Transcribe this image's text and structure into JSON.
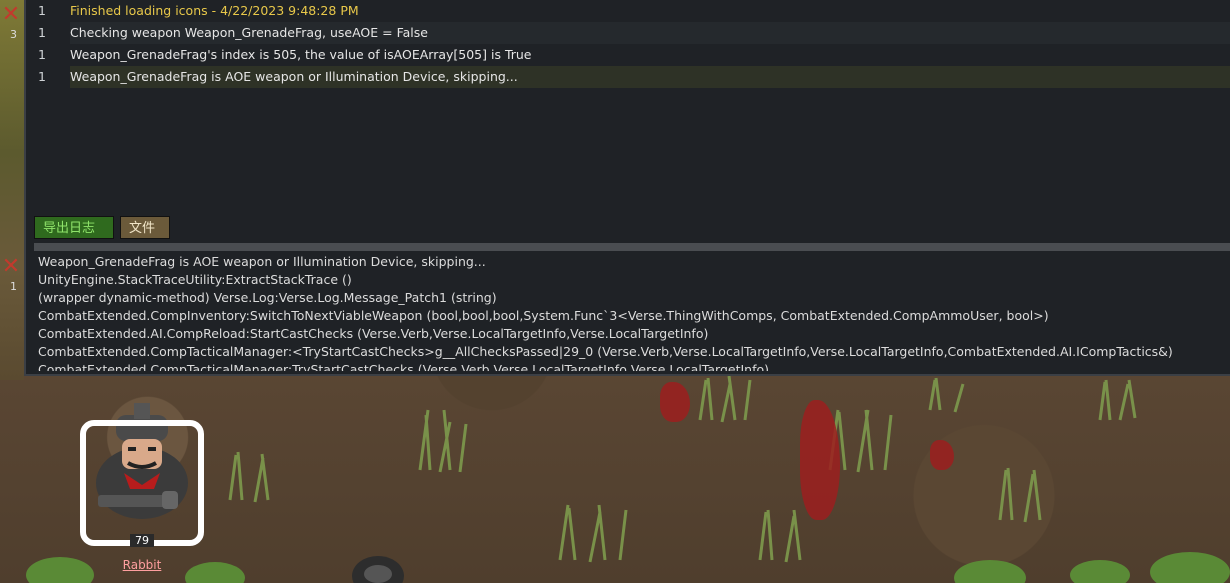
{
  "log": {
    "rows": [
      {
        "count": "1",
        "message": "Finished loading icons - 4/22/2023 9:48:28 PM"
      },
      {
        "count": "1",
        "message": "Checking weapon Weapon_GrenadeFrag, useAOE = False"
      },
      {
        "count": "1",
        "message": "Weapon_GrenadeFrag's index is 505, the value of isAOEArray[505] is True"
      },
      {
        "count": "1",
        "message": "Weapon_GrenadeFrag is AOE weapon or Illumination Device, skipping..."
      }
    ],
    "buttons": {
      "export": "导出日志",
      "file": "文件"
    },
    "stack_trace": [
      "Weapon_GrenadeFrag is AOE weapon or Illumination Device, skipping...",
      "UnityEngine.StackTraceUtility:ExtractStackTrace ()",
      "(wrapper dynamic-method) Verse.Log:Verse.Log.Message_Patch1 (string)",
      "CombatExtended.CompInventory:SwitchToNextViableWeapon (bool,bool,bool,System.Func`3<Verse.ThingWithComps, CombatExtended.CompAmmoUser, bool>)",
      "CombatExtended.AI.CompReload:StartCastChecks (Verse.Verb,Verse.LocalTargetInfo,Verse.LocalTargetInfo)",
      "CombatExtended.CompTacticalManager:<TryStartCastChecks>g__AllChecksPassed|29_0 (Verse.Verb,Verse.LocalTargetInfo,Verse.LocalTargetInfo,CombatExtended.AI.ICompTactics&)",
      "CombatExtended.CompTacticalManager:TryStartCastChecks (Verse.Verb,Verse.LocalTargetInfo,Verse.LocalTargetInfo)"
    ]
  },
  "side_badges": {
    "top": "3",
    "bottom": "1"
  },
  "pawn": {
    "name": "Rabbit",
    "number": "79"
  },
  "colors": {
    "highlight_text": "#e8c84a",
    "export_button": "#2f6a1e",
    "file_button": "#6b5a3a",
    "pawn_name": "#ff9f9f"
  }
}
